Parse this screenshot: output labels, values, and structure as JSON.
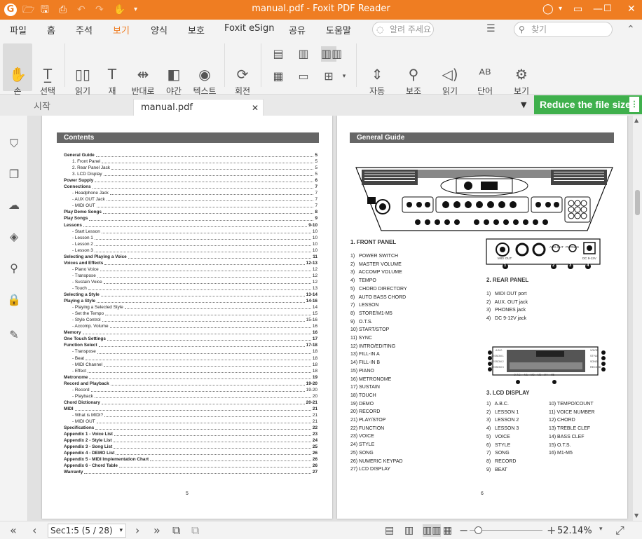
{
  "app": {
    "window_title": "manual.pdf - Foxit PDF Reader",
    "logo": "G"
  },
  "menu": {
    "items": [
      "파일",
      "홈",
      "주석",
      "보기",
      "양식",
      "보호",
      "Foxit eSign",
      "공유",
      "도움말"
    ],
    "tell_placeholder": "알려 주세요",
    "find_placeholder": "찾기"
  },
  "ribbon": {
    "hand": "손\n도구",
    "select": "선택",
    "read_mode": "읽기\n모드",
    "reflow": "재\n배치",
    "reverse": "반대로\n보기",
    "night": "야간\n모드",
    "text_viewer": "텍스트\n뷰어",
    "rotate": "회전",
    "auto_scroll": "자동\n스크롤",
    "assist": "보조",
    "read": "읽기",
    "word_count": "단어\n개수",
    "view_settings": "보기\n설정"
  },
  "tabs": {
    "home": "시작",
    "doc": "manual.pdf"
  },
  "promo": "Reduce the file size",
  "page5": {
    "header": "Contents",
    "toc": [
      {
        "t": "General Guide",
        "p": "5",
        "k": "b"
      },
      {
        "t": "1.    Front Panel",
        "p": "5",
        "k": "n"
      },
      {
        "t": "2.    Rear Panel Jack",
        "p": "5",
        "k": "n"
      },
      {
        "t": "3.    LCD Display",
        "p": "5",
        "k": "n"
      },
      {
        "t": "Power Supply",
        "p": "6",
        "k": "b"
      },
      {
        "t": "Connections",
        "p": "7",
        "k": "b"
      },
      {
        "t": "-     Headphone Jack",
        "p": "7",
        "k": "n"
      },
      {
        "t": "-     AUX OUT Jack",
        "p": "7",
        "k": "n"
      },
      {
        "t": "-     MIDI OUT",
        "p": "7",
        "k": "n"
      },
      {
        "t": "Play Demo Songs",
        "p": "8",
        "k": "b"
      },
      {
        "t": "Play Songs",
        "p": "9",
        "k": "b"
      },
      {
        "t": "Lessons",
        "p": "9-10",
        "k": "b"
      },
      {
        "t": "-     Start Lesson",
        "p": "10",
        "k": "n"
      },
      {
        "t": "-     Lesson 1",
        "p": "10",
        "k": "n"
      },
      {
        "t": "-     Lesson 2",
        "p": "10",
        "k": "n"
      },
      {
        "t": "-     Lesson 3",
        "p": "10",
        "k": "n"
      },
      {
        "t": "Selecting and Playing a Voice",
        "p": "11",
        "k": "b"
      },
      {
        "t": "Voices and Effects",
        "p": "12-13",
        "k": "b"
      },
      {
        "t": "-     Piano Voice",
        "p": "12",
        "k": "n"
      },
      {
        "t": "-     Transpose",
        "p": "12",
        "k": "n"
      },
      {
        "t": "-     Sustain Voice",
        "p": "12",
        "k": "n"
      },
      {
        "t": "-     Touch",
        "p": "13",
        "k": "n"
      },
      {
        "t": "Selecting a Style",
        "p": "13-14",
        "k": "b"
      },
      {
        "t": "Playing a Style",
        "p": "14-16",
        "k": "b"
      },
      {
        "t": "-     Playing a Selected Style",
        "p": "14",
        "k": "n"
      },
      {
        "t": "-     Set the Tempo",
        "p": "15",
        "k": "n"
      },
      {
        "t": "-     Style Control",
        "p": "15-16",
        "k": "n"
      },
      {
        "t": "-     Accomp. Volume",
        "p": "16",
        "k": "n"
      },
      {
        "t": "Memory",
        "p": "16",
        "k": "b"
      },
      {
        "t": "One Touch Settings",
        "p": "17",
        "k": "b"
      },
      {
        "t": "Function Select",
        "p": "17-18",
        "k": "b"
      },
      {
        "t": "-     Transpose",
        "p": "18",
        "k": "n"
      },
      {
        "t": "-     Beat",
        "p": "18",
        "k": "n"
      },
      {
        "t": "-     MIDI Channel",
        "p": "18",
        "k": "n"
      },
      {
        "t": "-     Effect",
        "p": "18",
        "k": "n"
      },
      {
        "t": "Metronome",
        "p": "19",
        "k": "b"
      },
      {
        "t": "Record and Playback",
        "p": "19-20",
        "k": "b"
      },
      {
        "t": "-     Record",
        "p": "19-20",
        "k": "n"
      },
      {
        "t": "-     Playback",
        "p": "20",
        "k": "n"
      },
      {
        "t": "Chord Dictionary",
        "p": "20-21",
        "k": "b"
      },
      {
        "t": "MIDI",
        "p": "21",
        "k": "b"
      },
      {
        "t": "-     What is MIDI?",
        "p": "21",
        "k": "n"
      },
      {
        "t": "-     MIDI OUT",
        "p": "21",
        "k": "n"
      },
      {
        "t": "Specifications",
        "p": "22",
        "k": "b"
      },
      {
        "t": "Appendix 1 - Voice List",
        "p": "23",
        "k": "b"
      },
      {
        "t": "Appendix 2 - Style List",
        "p": "24",
        "k": "b"
      },
      {
        "t": "Appendix 3 - Song List",
        "p": "25",
        "k": "b"
      },
      {
        "t": "Appendix 4 - DEMO List",
        "p": "26",
        "k": "b"
      },
      {
        "t": "Appendix 5 - MIDI Implementation Chart",
        "p": "26",
        "k": "b"
      },
      {
        "t": "Appendix 6 - Chord Table",
        "p": "26",
        "k": "b"
      },
      {
        "t": "Warranty",
        "p": "27",
        "k": "b"
      }
    ],
    "page_number": "5"
  },
  "page6": {
    "header": "General Guide",
    "front_panel_title": "1.   FRONT PANEL",
    "front_panel": [
      "1)   POWER SWITCH",
      "2)   MASTER VOLUME",
      "3)   ACCOMP VOLUME",
      "4)   TEMPO",
      "5)   CHORD DIRECTORY",
      "6)   AUTO BASS CHORD",
      "7)   LESSON",
      "8)   STORE/M1-M5",
      "9)   O.T.S.",
      "10) START/STOP",
      "11) SYNC",
      "12) INTRO/EDITING",
      "13) FILL-IN A",
      "14) FILL-IN B",
      "15) PIANO",
      "16) METRONOME",
      "17) SUSTAIN",
      "18) TOUCH",
      "19) DEMO",
      "20) RECORD",
      "21) PLAY/STOP",
      "22) FUNCTION",
      "23) VOICE",
      "24) STYLE",
      "25) SONG",
      "26) NUMERIC KEYPAD",
      "27) LCD DISPLAY"
    ],
    "rear_panel_title": "2.   REAR PANEL",
    "rear_panel": [
      "1)   MIDI OUT port",
      "2)   AUX. OUT jack",
      "3)   PHONES jack",
      "4)   DC 9-12V jack"
    ],
    "rear_labels": {
      "midi": "MIDI OUT",
      "aux": "AUX.OUT",
      "phones": "PHONES",
      "dc": "DC 9-12V",
      "n1": "1",
      "n2": "2",
      "n3": "3",
      "n4": "4"
    },
    "lcd_title": "3.   LCD DISPLAY",
    "lcd_left": [
      "1)   A.B.C.",
      "2)   LESSON 1",
      "3)   LESSON 2",
      "4)   LESSON 3",
      "5)   VOICE",
      "6)   STYLE",
      "7)   SONG",
      "8)   RECORD",
      "9)   BEAT"
    ],
    "lcd_right": [
      "10) TEMPO/COUNT",
      "11) VOICE NUMBER",
      "12) CHORD",
      "13) TREBLE CLEF",
      "14) BASS CLEF",
      "15) O.T.S.",
      "16) M1-M5"
    ],
    "lcd_labels": {
      "abc": "A.B.C.",
      "l1": "LESSON 1",
      "l2": "LESSON 2",
      "l3": "LESSON 3",
      "voice": "VOICE",
      "style": "STYLE",
      "song": "SONG",
      "record": "RECORD",
      "bottom": "O.T.S.    M1    M2    M3    M4    M5"
    },
    "page_number": "6"
  },
  "status": {
    "page_field": "Sec1:5 (5 / 28)",
    "zoom": "52.14%"
  }
}
